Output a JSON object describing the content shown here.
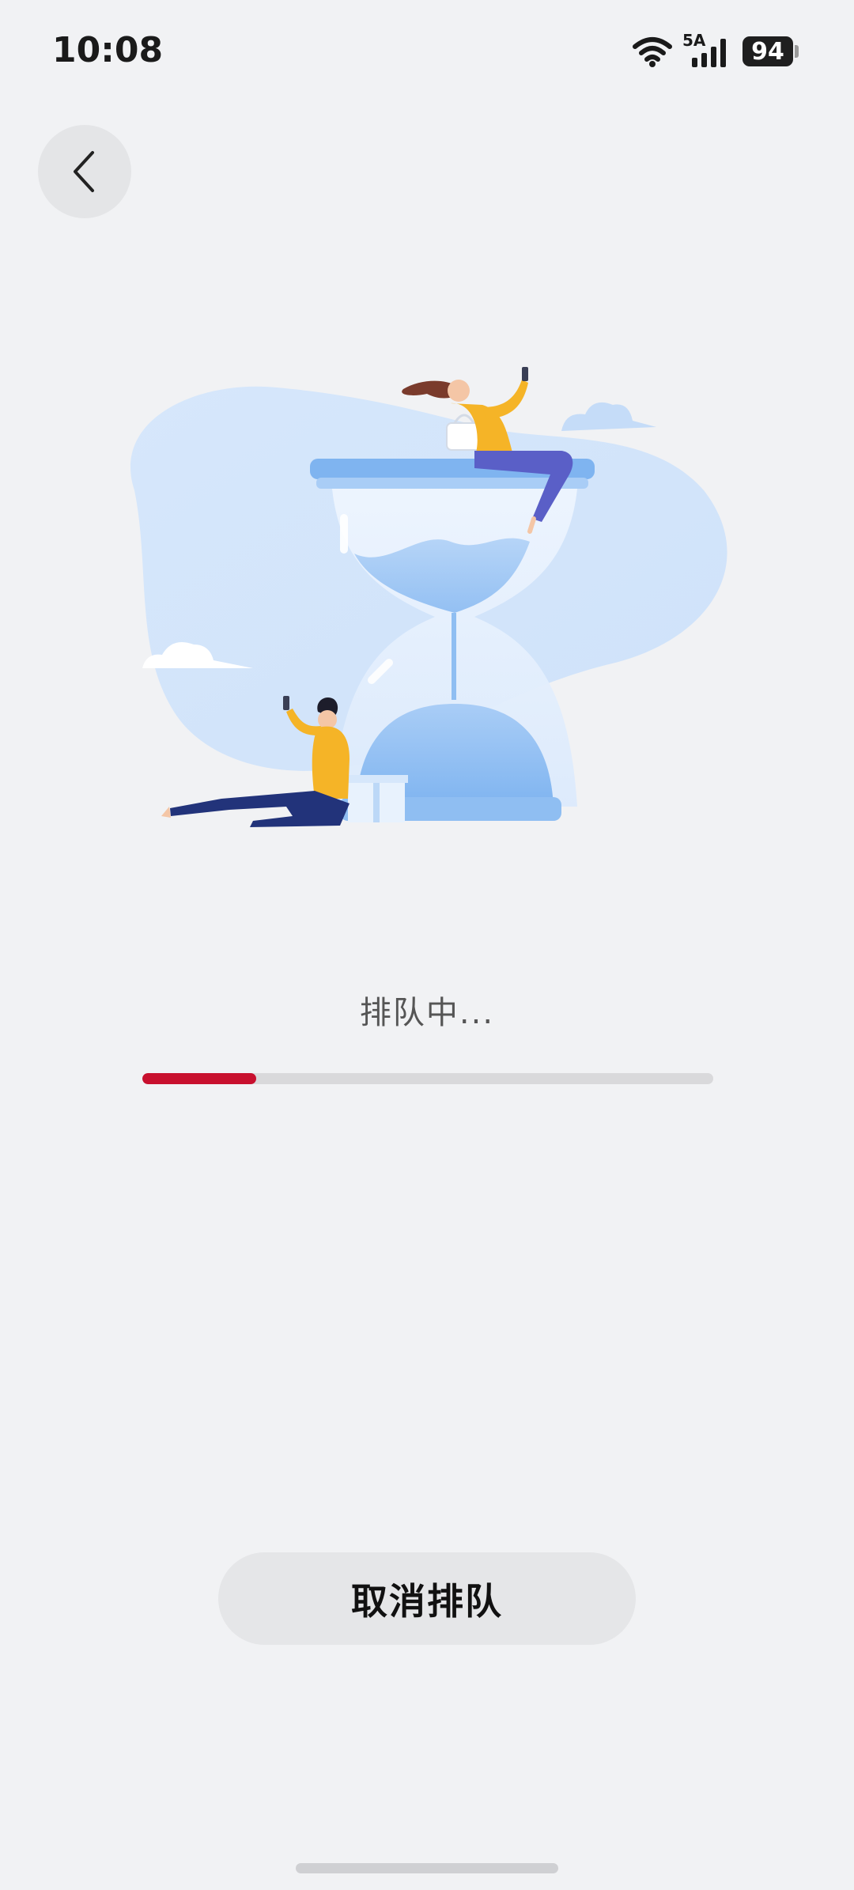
{
  "status_bar": {
    "time": "10:08",
    "network_label": "5A",
    "battery_level": "94",
    "icons": [
      "wifi-icon",
      "cellular-signal-icon",
      "battery-icon"
    ]
  },
  "nav": {
    "back_icon": "chevron-left-icon"
  },
  "illustration": {
    "description_icon": "hourglass-queue-illustration"
  },
  "queue": {
    "status_text": "排队中...",
    "progress_fraction": 0.2,
    "progress_color": "#c8102e"
  },
  "actions": {
    "cancel_label": "取消排队"
  }
}
